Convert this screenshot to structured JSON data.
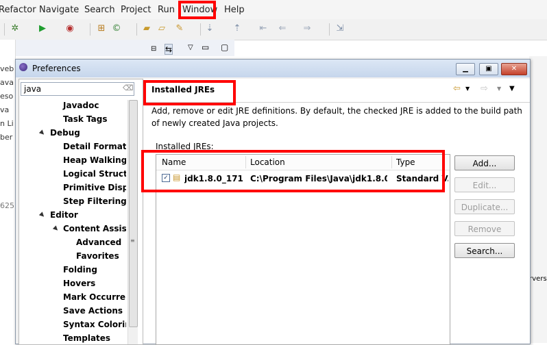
{
  "menubar": {
    "items": [
      "Refactor",
      "Navigate",
      "Search",
      "Project",
      "Run",
      "Window",
      "Help"
    ]
  },
  "toolbar": {
    "icons": [
      "debug-icon",
      "run-icon",
      "external-tools-icon",
      "new-package-icon",
      "new-class-icon",
      "open-folder-icon",
      "open-type-icon",
      "search-icon",
      "next-annotation-icon",
      "prev-annotation-icon",
      "back-icon",
      "forward-icon",
      "pin-icon"
    ]
  },
  "background": {
    "left_fragments": [
      "veb",
      "ava",
      "eso",
      "va",
      "n Li",
      "ber",
      "625"
    ],
    "right_fragment": "ervers"
  },
  "dialog": {
    "title": "Preferences",
    "filter_value": "java",
    "tree": [
      {
        "label": "Javadoc",
        "level": 1,
        "arrow": ""
      },
      {
        "label": "Task Tags",
        "level": 1,
        "arrow": ""
      },
      {
        "label": "Debug",
        "level": 0,
        "arrow": "▲"
      },
      {
        "label": "Detail Formatters",
        "level": 1,
        "arrow": ""
      },
      {
        "label": "Heap Walking",
        "level": 1,
        "arrow": ""
      },
      {
        "label": "Logical Structures",
        "level": 1,
        "arrow": ""
      },
      {
        "label": "Primitive Display",
        "level": 1,
        "arrow": ""
      },
      {
        "label": "Step Filtering",
        "level": 1,
        "arrow": ""
      },
      {
        "label": "Editor",
        "level": 0,
        "arrow": "▲"
      },
      {
        "label": "Content Assist",
        "level": 1,
        "arrow": "▲"
      },
      {
        "label": "Advanced",
        "level": 2,
        "arrow": ""
      },
      {
        "label": "Favorites",
        "level": 2,
        "arrow": ""
      },
      {
        "label": "Folding",
        "level": 1,
        "arrow": ""
      },
      {
        "label": "Hovers",
        "level": 1,
        "arrow": ""
      },
      {
        "label": "Mark Occurrences",
        "level": 1,
        "arrow": ""
      },
      {
        "label": "Save Actions",
        "level": 1,
        "arrow": ""
      },
      {
        "label": "Syntax Coloring",
        "level": 1,
        "arrow": ""
      },
      {
        "label": "Templates",
        "level": 1,
        "arrow": ""
      }
    ],
    "page": {
      "title": "Installed JREs",
      "description_line1": "Add, remove or edit JRE definitions. By default, the checked JRE is added to the build path",
      "description_line2": "of newly created Java projects.",
      "list_label": "Installed JREs:",
      "columns": [
        "Name",
        "Location",
        "Type"
      ],
      "rows": [
        {
          "checked": true,
          "name": "jdk1.8.0_171...",
          "location": "C:\\Program Files\\Java\\jdk1.8.0...",
          "type": "Standard V..."
        }
      ],
      "buttons": {
        "add": "Add...",
        "edit": "Edit...",
        "duplicate": "Duplicate...",
        "remove": "Remove",
        "search": "Search..."
      }
    }
  },
  "colors": {
    "highlight_box": "#ff0000",
    "titlebar": "#c6d6ec"
  }
}
